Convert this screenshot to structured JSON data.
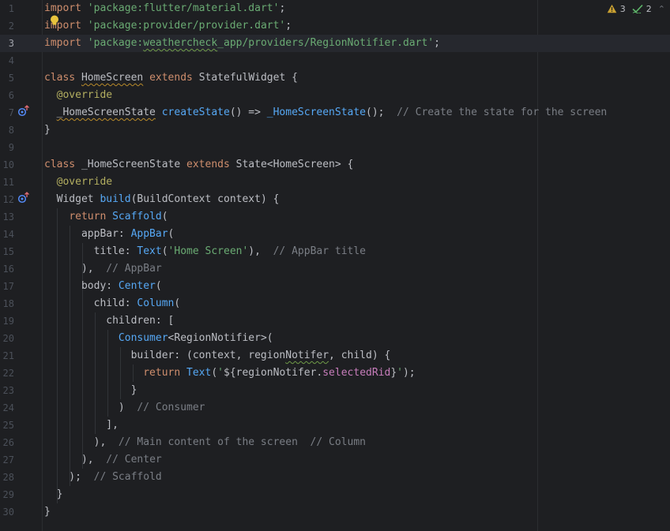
{
  "editor": {
    "current_line": 3,
    "lines": [
      {
        "n": "1",
        "tokens": [
          {
            "t": "import ",
            "c": "kw"
          },
          {
            "t": "'package:flutter/material.dart'",
            "c": "str"
          },
          {
            "t": ";"
          }
        ]
      },
      {
        "n": "2",
        "tokens": [
          {
            "t": "import ",
            "c": "kw"
          },
          {
            "t": "'package:provider/provider.dart'",
            "c": "str"
          },
          {
            "t": ";"
          }
        ]
      },
      {
        "n": "3",
        "tokens": [
          {
            "t": "import ",
            "c": "kw"
          },
          {
            "t": "'package:",
            "c": "str"
          },
          {
            "t": "weathercheck",
            "c": "str sq"
          },
          {
            "t": "_app/providers/RegionNotifier.dart'",
            "c": "str"
          },
          {
            "t": ";"
          }
        ]
      },
      {
        "n": "4",
        "tokens": []
      },
      {
        "n": "5",
        "tokens": [
          {
            "t": "class ",
            "c": "kw"
          },
          {
            "t": "HomeScreen",
            "c": "cls sq-warn"
          },
          {
            "t": " extends ",
            "c": "kw"
          },
          {
            "t": "StatefulWidget {"
          }
        ]
      },
      {
        "n": "6",
        "tokens": [
          {
            "t": "  "
          },
          {
            "t": "@override",
            "c": "ann"
          }
        ]
      },
      {
        "n": "7",
        "tokens": [
          {
            "t": "  "
          },
          {
            "t": "_HomeScreenState",
            "c": "sq-warn"
          },
          {
            "t": " "
          },
          {
            "t": "createState",
            "c": "fn"
          },
          {
            "t": "() => "
          },
          {
            "t": "_HomeScreenState",
            "c": "fn"
          },
          {
            "t": "();  "
          },
          {
            "t": "// Create the state for the screen",
            "c": "cmt"
          }
        ]
      },
      {
        "n": "8",
        "tokens": [
          {
            "t": "}"
          }
        ]
      },
      {
        "n": "9",
        "tokens": []
      },
      {
        "n": "10",
        "tokens": [
          {
            "t": "class ",
            "c": "kw"
          },
          {
            "t": "_HomeScreenState"
          },
          {
            "t": " extends ",
            "c": "kw"
          },
          {
            "t": "State<HomeScreen> {"
          }
        ]
      },
      {
        "n": "11",
        "tokens": [
          {
            "t": "  "
          },
          {
            "t": "@override",
            "c": "ann"
          }
        ]
      },
      {
        "n": "12",
        "tokens": [
          {
            "t": "  Widget "
          },
          {
            "t": "build",
            "c": "fn"
          },
          {
            "t": "(BuildContext context) {"
          }
        ]
      },
      {
        "n": "13",
        "tokens": [
          {
            "t": "    "
          },
          {
            "t": "return ",
            "c": "kw"
          },
          {
            "t": "Scaffold",
            "c": "fn"
          },
          {
            "t": "("
          }
        ]
      },
      {
        "n": "14",
        "tokens": [
          {
            "t": "      appBar: "
          },
          {
            "t": "AppBar",
            "c": "fn"
          },
          {
            "t": "("
          }
        ]
      },
      {
        "n": "15",
        "tokens": [
          {
            "t": "        title: "
          },
          {
            "t": "Text",
            "c": "fn"
          },
          {
            "t": "("
          },
          {
            "t": "'Home Screen'",
            "c": "str"
          },
          {
            "t": "),  "
          },
          {
            "t": "// AppBar title",
            "c": "cmt"
          }
        ]
      },
      {
        "n": "16",
        "tokens": [
          {
            "t": "      ),  "
          },
          {
            "t": "// AppBar",
            "c": "cmt"
          }
        ]
      },
      {
        "n": "17",
        "tokens": [
          {
            "t": "      body: "
          },
          {
            "t": "Center",
            "c": "fn"
          },
          {
            "t": "("
          }
        ]
      },
      {
        "n": "18",
        "tokens": [
          {
            "t": "        child: "
          },
          {
            "t": "Column",
            "c": "fn"
          },
          {
            "t": "("
          }
        ]
      },
      {
        "n": "19",
        "tokens": [
          {
            "t": "          children: ["
          }
        ]
      },
      {
        "n": "20",
        "tokens": [
          {
            "t": "            "
          },
          {
            "t": "Consumer",
            "c": "fn"
          },
          {
            "t": "<RegionNotifier>("
          }
        ]
      },
      {
        "n": "21",
        "tokens": [
          {
            "t": "              builder: (context, region"
          },
          {
            "t": "Notifer",
            "c": "sq"
          },
          {
            "t": ", child) {"
          }
        ]
      },
      {
        "n": "22",
        "tokens": [
          {
            "t": "                "
          },
          {
            "t": "return ",
            "c": "kw"
          },
          {
            "t": "Text",
            "c": "fn"
          },
          {
            "t": "("
          },
          {
            "t": "'",
            "c": "str"
          },
          {
            "t": "${regionNotifer."
          },
          {
            "t": "selectedRid",
            "c": "field"
          },
          {
            "t": "}"
          },
          {
            "t": "'",
            "c": "str"
          },
          {
            "t": ");"
          }
        ]
      },
      {
        "n": "23",
        "tokens": [
          {
            "t": "              }"
          }
        ]
      },
      {
        "n": "24",
        "tokens": [
          {
            "t": "            )  "
          },
          {
            "t": "// Consumer",
            "c": "cmt"
          }
        ]
      },
      {
        "n": "25",
        "tokens": [
          {
            "t": "          ],"
          }
        ]
      },
      {
        "n": "26",
        "tokens": [
          {
            "t": "        ),  "
          },
          {
            "t": "// Main content of the screen  // Column",
            "c": "cmt"
          }
        ]
      },
      {
        "n": "27",
        "tokens": [
          {
            "t": "      ),  "
          },
          {
            "t": "// Center",
            "c": "cmt"
          }
        ]
      },
      {
        "n": "28",
        "tokens": [
          {
            "t": "    );  "
          },
          {
            "t": "// Scaffold",
            "c": "cmt"
          }
        ]
      },
      {
        "n": "29",
        "tokens": [
          {
            "t": "  }"
          }
        ]
      },
      {
        "n": "30",
        "tokens": [
          {
            "t": "}"
          }
        ]
      }
    ]
  },
  "status": {
    "warnings": "3",
    "ok": "2"
  },
  "colors": {
    "background": "#1e1f22",
    "keyword": "#cf8e6d",
    "string": "#6aab73",
    "function": "#56a8f5",
    "annotation": "#b3ae60",
    "comment": "#7a7e85"
  }
}
